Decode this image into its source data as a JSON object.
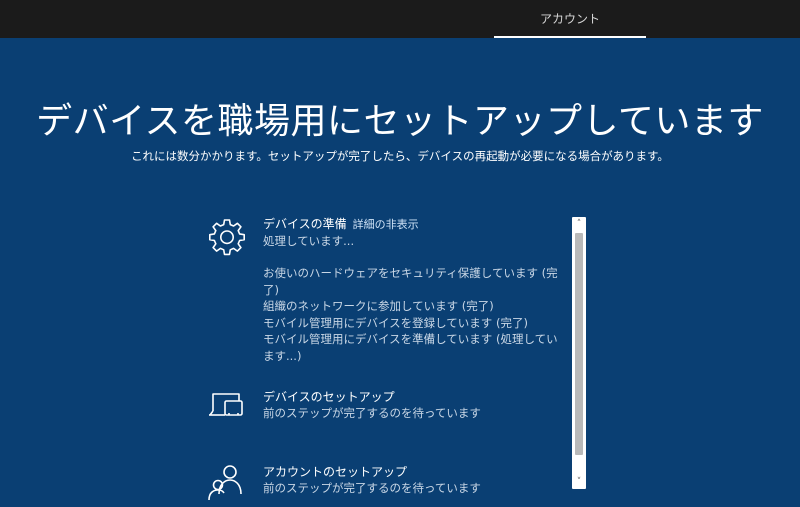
{
  "header": {
    "tab_label": "アカウント"
  },
  "main": {
    "title": "デバイスを職場用にセットアップしています",
    "subtitle": "これには数分かかります。セットアップが完了したら、デバイスの再起動が必要になる場合があります。"
  },
  "steps": [
    {
      "icon": "gear-icon",
      "title": "デバイスの準備",
      "detail_link": "詳細の非表示",
      "status": "処理しています...",
      "subitems": [
        "お使いのハードウェアをセキュリティ保護しています (完",
        "了)",
        "組織のネットワークに参加しています (完了)",
        "モバイル管理用にデバイスを登録しています (完了)",
        "モバイル管理用にデバイスを準備しています (処理してい",
        "ます...)"
      ]
    },
    {
      "icon": "device-setup-icon",
      "title": "デバイスのセットアップ",
      "status": "前のステップが完了するのを待っています"
    },
    {
      "icon": "account-icon",
      "title": "アカウントのセットアップ",
      "status": "前のステップが完了するのを待っています"
    }
  ],
  "scrollbar": {
    "up_glyph": "˄",
    "down_glyph": "˅"
  },
  "colors": {
    "background": "#0a3f73",
    "topbar": "#1b1b1b",
    "text": "#ffffff",
    "muted_text": "#c9d7e6"
  }
}
